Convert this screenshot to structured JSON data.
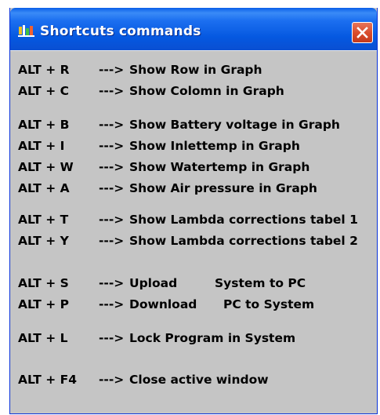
{
  "window": {
    "title": "Shortcuts commands",
    "icon": "app-icon",
    "close_icon": "close-icon"
  },
  "colors": {
    "titlebar": "#0558e0",
    "body": "#c5c5c5",
    "close": "#d84a2a"
  },
  "shortcuts": [
    {
      "key": "ALT + R",
      "arrow": "--->",
      "desc": "Show Row in Graph",
      "extra": ""
    },
    {
      "key": "ALT + C",
      "arrow": "--->",
      "desc": "Show Colomn in Graph",
      "extra": ""
    },
    {
      "key": "ALT + B",
      "arrow": "--->",
      "desc": "Show Battery voltage in Graph",
      "extra": ""
    },
    {
      "key": "ALT + I",
      "arrow": "--->",
      "desc": "Show Inlettemp in Graph",
      "extra": ""
    },
    {
      "key": "ALT + W",
      "arrow": "--->",
      "desc": "Show Watertemp in Graph",
      "extra": ""
    },
    {
      "key": "ALT + A",
      "arrow": "--->",
      "desc": "Show Air pressure in Graph",
      "extra": ""
    },
    {
      "key": "ALT + T",
      "arrow": "--->",
      "desc": "Show Lambda corrections tabel 1",
      "extra": ""
    },
    {
      "key": "ALT + Y",
      "arrow": "--->",
      "desc": "Show Lambda corrections tabel 2",
      "extra": ""
    },
    {
      "key": "ALT + S",
      "arrow": "--->",
      "desc": "Upload",
      "extra": "System to PC"
    },
    {
      "key": "ALT + P",
      "arrow": "--->",
      "desc": "Download",
      "extra": "PC to System"
    },
    {
      "key": "ALT + L",
      "arrow": "--->",
      "desc": "Lock Program in System",
      "extra": ""
    },
    {
      "key": "ALT + F4",
      "arrow": "--->",
      "desc": "Close active window",
      "extra": ""
    }
  ]
}
